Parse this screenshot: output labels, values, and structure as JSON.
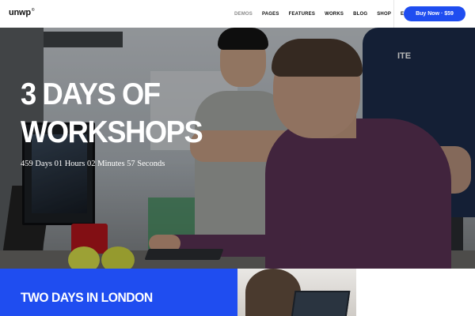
{
  "header": {
    "logo_text": "unwp",
    "logo_sup": "©",
    "nav_items": [
      {
        "label": "DEMOS",
        "muted": true
      },
      {
        "label": "PAGES"
      },
      {
        "label": "FEATURES"
      },
      {
        "label": "WORKS"
      },
      {
        "label": "BLOG"
      },
      {
        "label": "SHOP"
      },
      {
        "label": "EXTRA"
      }
    ],
    "buy_button": "Buy Now · $59"
  },
  "hero": {
    "title_line1": "3 DAYS OF",
    "title_line2": "WORKSHOPS",
    "countdown": "459 Days 01 Hours 02 Minutes 57 Seconds",
    "shirt_logo": "ITE"
  },
  "section2": {
    "title": "TWO DAYS IN LONDON"
  },
  "colors": {
    "accent": "#1f4df0",
    "text_dark": "#111111",
    "nav_muted": "#8a8a8a"
  },
  "icons": {
    "brand": "unwp-logo"
  }
}
